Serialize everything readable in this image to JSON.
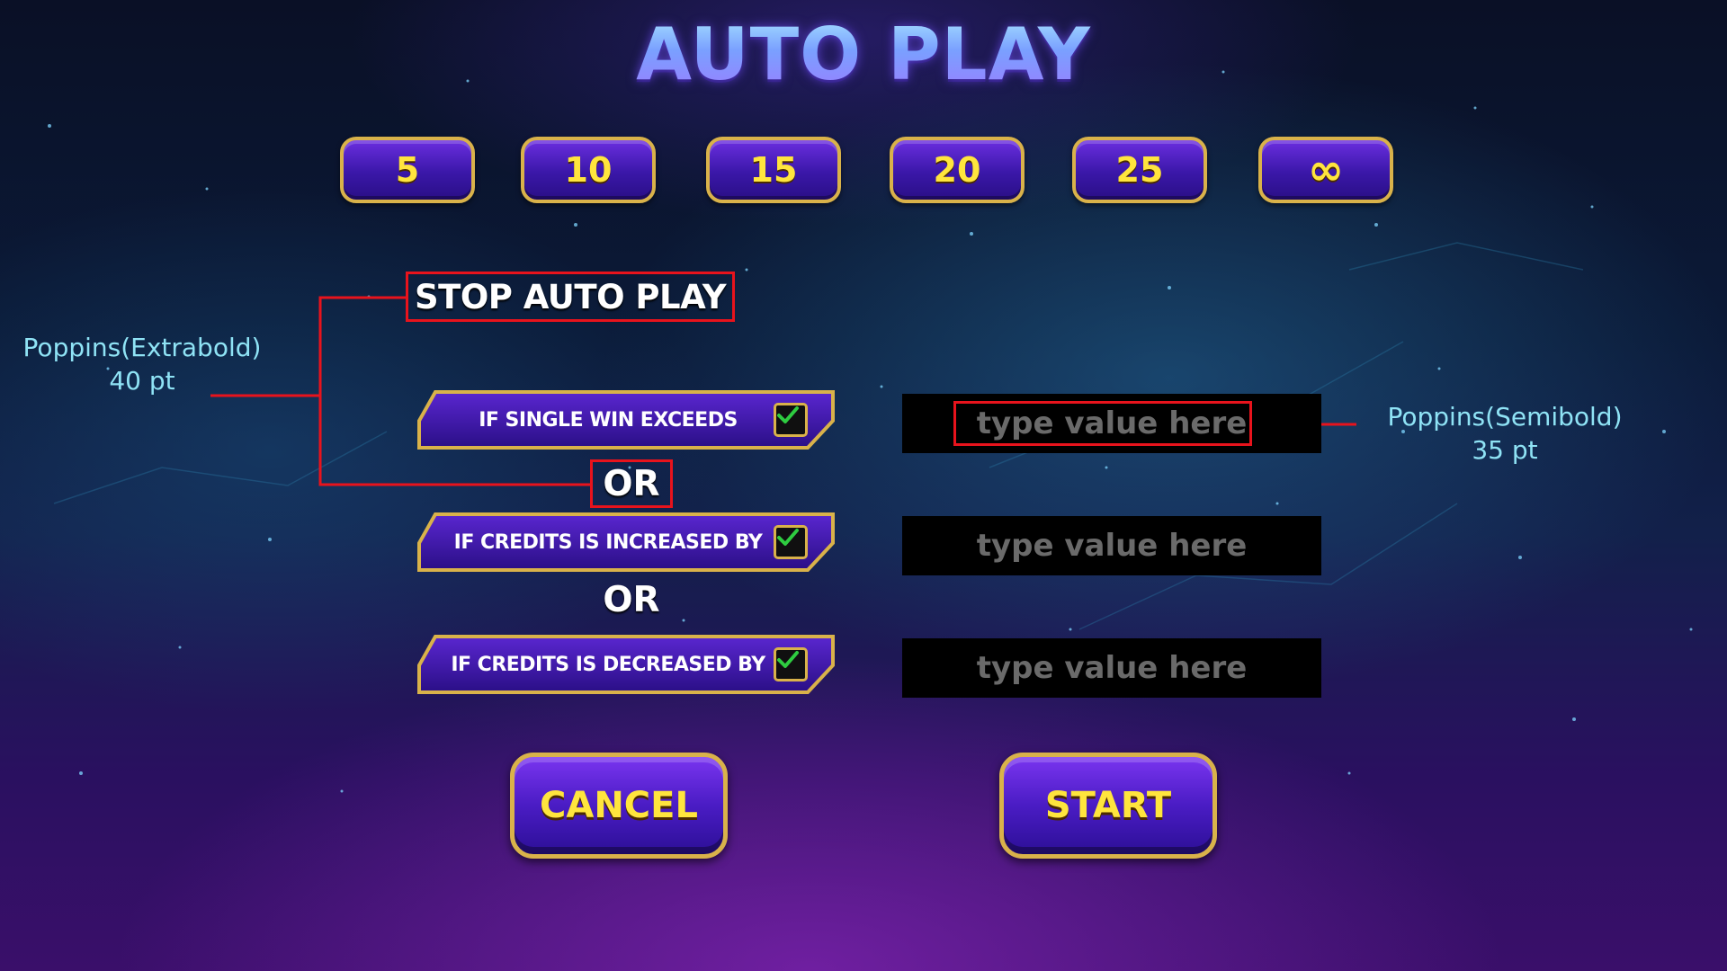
{
  "title": "AUTO PLAY",
  "spin_counts": [
    {
      "label": "5"
    },
    {
      "label": "10"
    },
    {
      "label": "15"
    },
    {
      "label": "20"
    },
    {
      "label": "25"
    },
    {
      "label": "∞"
    }
  ],
  "stop_section": {
    "title": "STOP AUTO PLAY",
    "or_label": "OR",
    "conditions": [
      {
        "label": "IF SINGLE WIN EXCEEDS",
        "checked": true,
        "placeholder": "type value here"
      },
      {
        "label": "IF CREDITS IS INCREASED BY",
        "checked": true,
        "placeholder": "type value here"
      },
      {
        "label": "IF CREDITS IS DECREASED BY",
        "checked": true,
        "placeholder": "type value here"
      }
    ]
  },
  "buttons": {
    "cancel": "CANCEL",
    "start": "START"
  },
  "annotations": {
    "left_font": "Poppins(Extrabold)",
    "left_size": "40 pt",
    "right_font": "Poppins(Semibold)",
    "right_size": "35 pt"
  },
  "colors": {
    "accent_gold": "#d9b24a",
    "button_text": "#ffe53d",
    "annotation_red": "#e8131c",
    "annotation_text": "#8fe3f5",
    "check_green": "#2ecc40"
  }
}
